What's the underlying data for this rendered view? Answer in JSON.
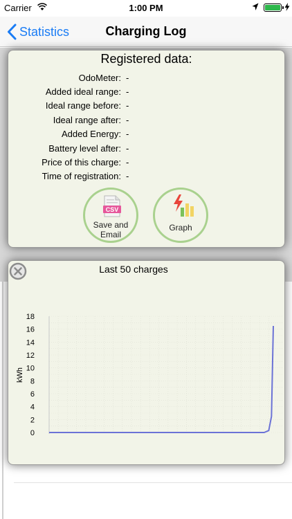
{
  "status_bar": {
    "carrier": "Carrier",
    "time": "1:00 PM"
  },
  "nav": {
    "back_label": "Statistics",
    "title": "Charging Log"
  },
  "registered": {
    "heading": "Registered data:",
    "rows": [
      {
        "label": "OdoMeter:",
        "value": "-"
      },
      {
        "label": "Added ideal range:",
        "value": "-"
      },
      {
        "label": "Ideal range before:",
        "value": "-"
      },
      {
        "label": "Ideal range after:",
        "value": "-"
      },
      {
        "label": "Added Energy:",
        "value": "-"
      },
      {
        "label": "Battery level after:",
        "value": "-"
      },
      {
        "label": "Price of this charge:",
        "value": "-"
      },
      {
        "label": "Time of registration:",
        "value": "-"
      }
    ],
    "csv_badge": "CSV",
    "csv_button_line1": "Save and",
    "csv_button_line2": "Email",
    "graph_button": "Graph"
  },
  "chart_data": {
    "type": "line",
    "title": "Last 50 charges",
    "xlabel": "",
    "ylabel": "kWh",
    "ylim": [
      0,
      18
    ],
    "yticks": [
      0,
      2,
      4,
      6,
      8,
      10,
      12,
      14,
      16,
      18
    ],
    "grid": true,
    "series": [
      {
        "color": "#6b72d6",
        "x": [
          1,
          40,
          45,
          48,
          49,
          49.6,
          50
        ],
        "values": [
          0,
          0,
          0,
          0,
          0.3,
          2.5,
          16.5
        ]
      }
    ]
  }
}
